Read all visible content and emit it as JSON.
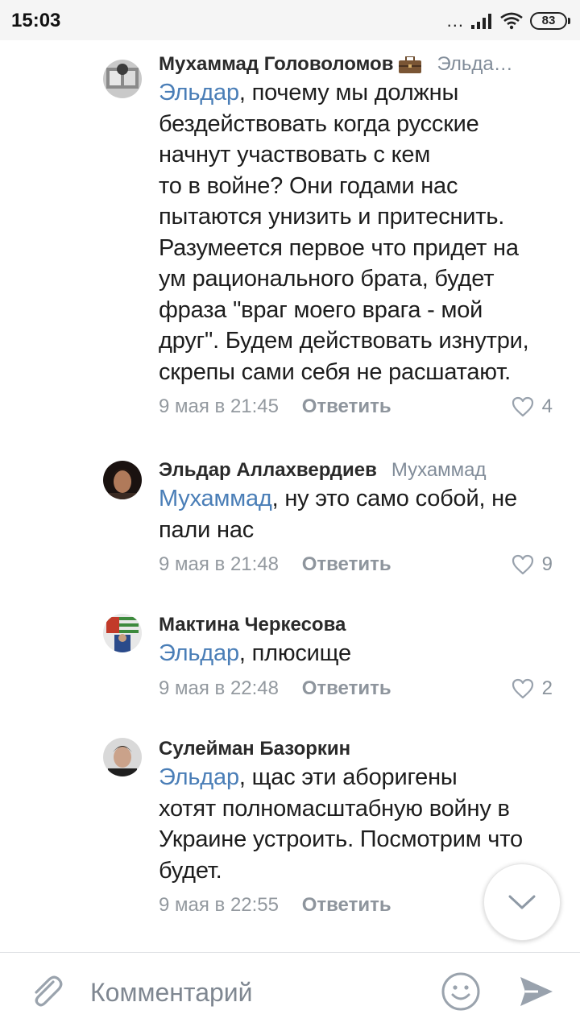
{
  "status_bar": {
    "time": "15:03",
    "signal_dots": "...",
    "battery": "83"
  },
  "comments": [
    {
      "author": "Мухаммад Головоломов",
      "badge_icon": "briefcase-icon",
      "reply_to": "Эльда…",
      "mention": "Эльдар",
      "lines": [
        ", почему мы должны",
        "бездействовать когда русские",
        "начнут участвовать с кем",
        "то в войне? Они годами нас",
        "пытаются унизить и притеснить.",
        "Разумеется первое что придет на",
        "ум рационального брата, будет",
        "фраза \"враг моего врага - мой",
        "друг\". Будем действовать изнутри,",
        "скрепы сами себя не расшатают."
      ],
      "date": "9 мая в 21:45",
      "reply_label": "Ответить",
      "likes": "4"
    },
    {
      "author": "Эльдар Аллахвердиев",
      "reply_to": "Мухаммад",
      "mention": "Мухаммад",
      "lines": [
        ", ну это само собой, не",
        "пали нас"
      ],
      "date": "9 мая в 21:48",
      "reply_label": "Ответить",
      "likes": "9"
    },
    {
      "author": "Мактина Черкесова",
      "reply_to": "",
      "mention": "Эльдар",
      "lines": [
        ", плюсище"
      ],
      "date": "9 мая в 22:48",
      "reply_label": "Ответить",
      "likes": "2"
    },
    {
      "author": "Сулейман Базоркин",
      "reply_to": "",
      "mention": "Эльдар",
      "lines": [
        ", щас эти аборигены",
        "хотят полномасштабную войну в",
        "Украине устроить. Посмотрим что",
        "будет."
      ],
      "date": "9 мая в 22:55",
      "reply_label": "Ответить",
      "likes": ""
    }
  ],
  "composer": {
    "placeholder": "Комментарий"
  },
  "colors": {
    "mention": "#4a7eb7",
    "meta": "#93999f",
    "icon": "#9aa3ad"
  }
}
